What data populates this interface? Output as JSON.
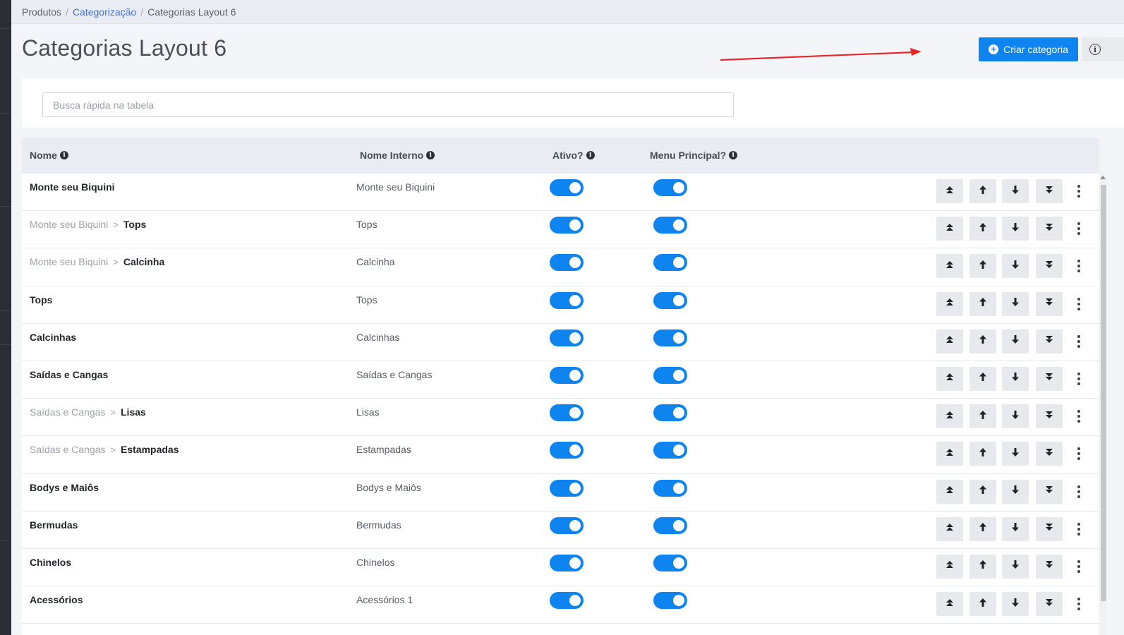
{
  "breadcrumb": [
    "Produtos",
    "Categorização",
    "Categorias Layout 6"
  ],
  "page": {
    "title": "Categorias Layout 6"
  },
  "header": {
    "create_label": "Criar categoria",
    "accent_color": "#0d84f0",
    "annotation_color": "#e8262a"
  },
  "search": {
    "placeholder": "Busca rápida na tabela",
    "value": ""
  },
  "table": {
    "columns": [
      "Nome",
      "Nome Interno",
      "Ativo?",
      "Menu Principal?"
    ],
    "rows": [
      {
        "parent": "",
        "name": "Monte seu Biquini",
        "internal": "Monte seu Biquini",
        "active": true,
        "main_menu": true
      },
      {
        "parent": "Monte seu Biquini",
        "name": "Tops",
        "internal": "Tops",
        "active": true,
        "main_menu": true
      },
      {
        "parent": "Monte seu Biquini",
        "name": "Calcinha",
        "internal": "Calcinha",
        "active": true,
        "main_menu": true
      },
      {
        "parent": "",
        "name": "Tops",
        "internal": "Tops",
        "active": true,
        "main_menu": true
      },
      {
        "parent": "",
        "name": "Calcinhas",
        "internal": "Calcinhas",
        "active": true,
        "main_menu": true
      },
      {
        "parent": "",
        "name": "Saídas e Cangas",
        "internal": "Saídas e Cangas",
        "active": true,
        "main_menu": true
      },
      {
        "parent": "Saídas e Cangas",
        "name": "Lisas",
        "internal": "Lisas",
        "active": true,
        "main_menu": true
      },
      {
        "parent": "Saídas e Cangas",
        "name": "Estampadas",
        "internal": "Estampadas",
        "active": true,
        "main_menu": true
      },
      {
        "parent": "",
        "name": "Bodys e Maiôs",
        "internal": "Bodys e Maiôs",
        "active": true,
        "main_menu": true
      },
      {
        "parent": "",
        "name": "Bermudas",
        "internal": "Bermudas",
        "active": true,
        "main_menu": true
      },
      {
        "parent": "",
        "name": "Chinelos",
        "internal": "Chinelos",
        "active": true,
        "main_menu": true
      },
      {
        "parent": "",
        "name": "Acessórios",
        "internal": "Acessórios 1",
        "active": true,
        "main_menu": true
      }
    ],
    "separator": ">",
    "row_action_icons": [
      "move-top-icon",
      "move-up-icon",
      "move-down-icon",
      "move-bottom-icon",
      "more-options-icon"
    ]
  }
}
